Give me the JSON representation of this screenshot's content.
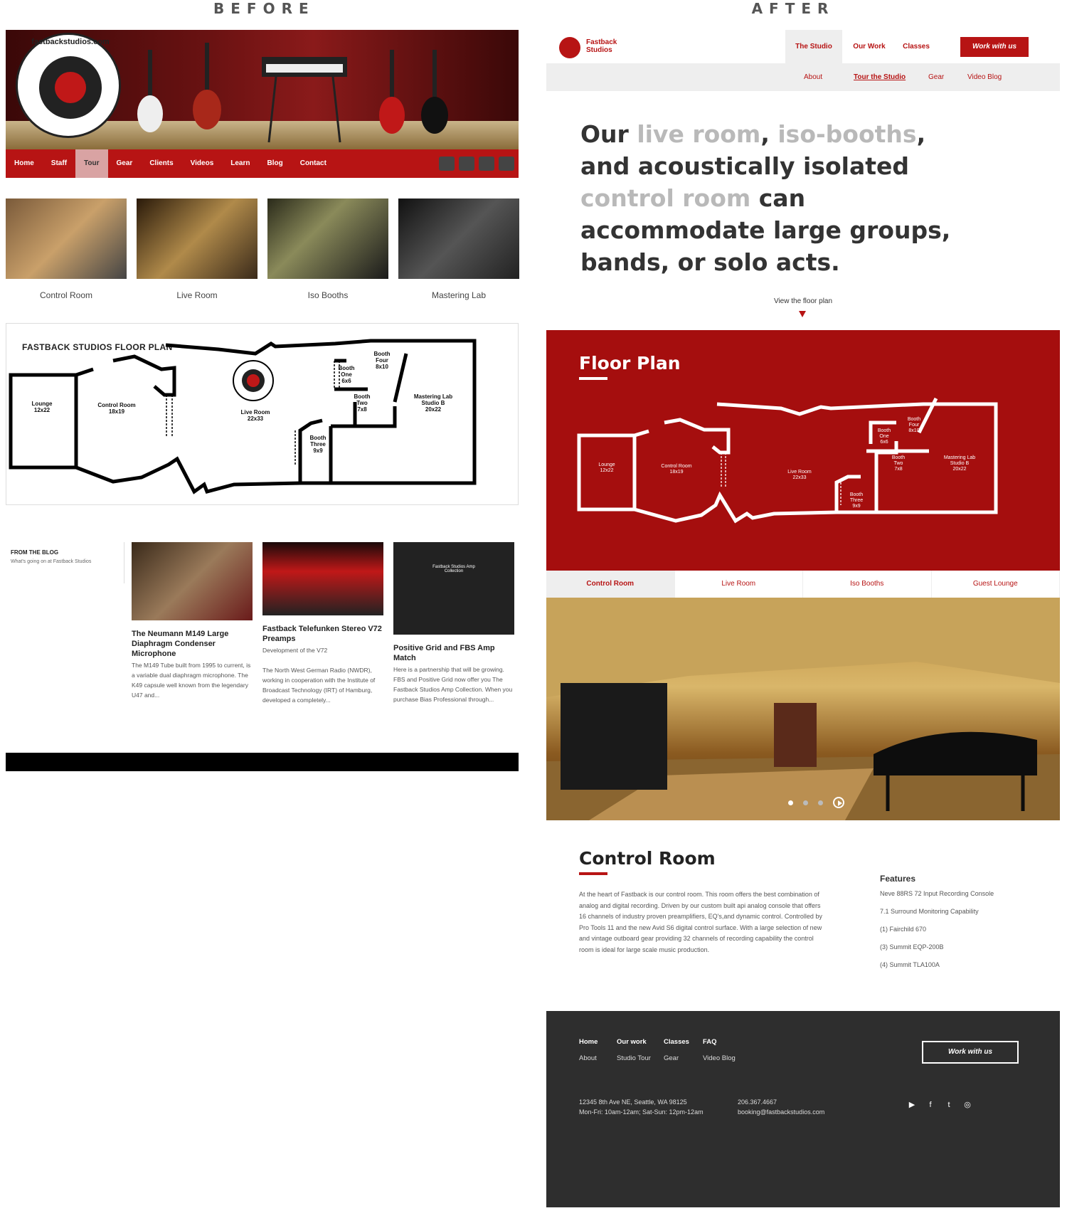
{
  "labels": {
    "before": "BEFORE",
    "after": "AFTER"
  },
  "before": {
    "nav": [
      "Home",
      "Staff",
      "Tour",
      "Gear",
      "Clients",
      "Videos",
      "Learn",
      "Blog",
      "Contact"
    ],
    "nav_selected": "Tour",
    "logo_text": "fastbackstudios.com",
    "thumbs": [
      "Control Room",
      "Live Room",
      "Iso Booths",
      "Mastering Lab"
    ],
    "plan": {
      "title": "FASTBACK STUDIOS FLOOR PLAN",
      "rooms": [
        {
          "name": "Lounge",
          "size": "12x22"
        },
        {
          "name": "Control Room",
          "size": "18x19"
        },
        {
          "name": "Live Room",
          "size": "22x33"
        },
        {
          "name": "Booth One",
          "size": "6x6"
        },
        {
          "name": "Booth Two",
          "size": "7x8"
        },
        {
          "name": "Booth Three",
          "size": "9x9"
        },
        {
          "name": "Booth Four",
          "size": "8x10"
        },
        {
          "name": "Mastering Lab Studio B",
          "size": "20x22"
        }
      ]
    },
    "blog": {
      "heading": "FROM THE BLOG",
      "sub": "What's going on at Fastback Studios",
      "posts": [
        {
          "title": "The Neumann M149 Large Diaphragm Condenser Microphone",
          "sub": "",
          "excerpt": "The M149 Tube built from 1995 to current, is a variable dual diaphragm microphone. The K49 capsule well known from the legendary U47 and..."
        },
        {
          "title": "Fastback Telefunken Stereo V72 Preamps",
          "sub": "Development of the V72",
          "excerpt": "The North West German Radio (NWDR), working in cooperation with the Institute of Broadcast Technology (IRT) of Hamburg, developed a completely..."
        },
        {
          "title": "Positive Grid and FBS Amp Match",
          "sub": "",
          "excerpt": "Here is a partnership that will be growing. FBS and Positive Grid now offer you The Fastback Studios Amp Collection. When you purchase Bias Professional through..."
        }
      ],
      "post3_img_text": "Fastback Studios Amp Collection"
    }
  },
  "after": {
    "logo_text_1": "Fastback",
    "logo_text_2": "Studios",
    "nav": [
      "The Studio",
      "Our Work",
      "Classes"
    ],
    "nav_selected": "The Studio",
    "cta": "Work with us",
    "subnav": [
      "About",
      "Tour the Studio",
      "Gear",
      "Video Blog"
    ],
    "subnav_selected": "Tour the Studio",
    "hero": {
      "p1": "Our ",
      "g1": "live room",
      "p2": ", ",
      "g2": "iso-booths",
      "p3": ", and acoustically isolated ",
      "g3": "control room",
      "p4": " can accommodate large groups, bands, or solo acts."
    },
    "floor_link": "View the floor plan",
    "plan_title": "Floor Plan",
    "tabs": [
      "Control Room",
      "Live Room",
      "Iso Booths",
      "Guest Lounge"
    ],
    "tab_selected": "Control Room",
    "section_title": "Control Room",
    "section_text": "At the heart of Fastback is our control room. This room offers the best combination of analog and digital recording. Driven by our custom built api analog console that offers 16 channels of industry proven preamplifiers, EQ's,and dynamic control. Controlled by Pro Tools 11 and the new Avid S6 digital control surface. With a large selection of new and vintage outboard gear providing 32 channels of recording capability the control room is ideal for large scale music production.",
    "features_title": "Features",
    "features": [
      "Neve 88RS 72 Input Recording Console",
      "7.1 Surround Monitoring Capability",
      "(1) Fairchild 670",
      "(3) Summit EQP-200B",
      "(4) Summit TLA100A"
    ],
    "footer": {
      "cols": [
        {
          "a": "Home",
          "b": "About"
        },
        {
          "a": "Our work",
          "b": "Studio Tour"
        },
        {
          "a": "Classes",
          "b": "Gear"
        },
        {
          "a": "FAQ",
          "b": "Video Blog"
        }
      ],
      "cta": "Work with us",
      "address": "12345 8th Ave NE, Seattle, WA 98125",
      "hours": "Mon-Fri: 10am-12am; Sat-Sun: 12pm-12am",
      "phone": "206.367.4667",
      "email": "booking@fastbackstudios.com",
      "social_icons": [
        "youtube-icon",
        "facebook-icon",
        "twitter-icon",
        "instagram-icon"
      ]
    }
  },
  "colors": {
    "brand_red": "#b71414",
    "plan_red": "#a50e0e",
    "footer_bg": "#2e2e2e"
  }
}
